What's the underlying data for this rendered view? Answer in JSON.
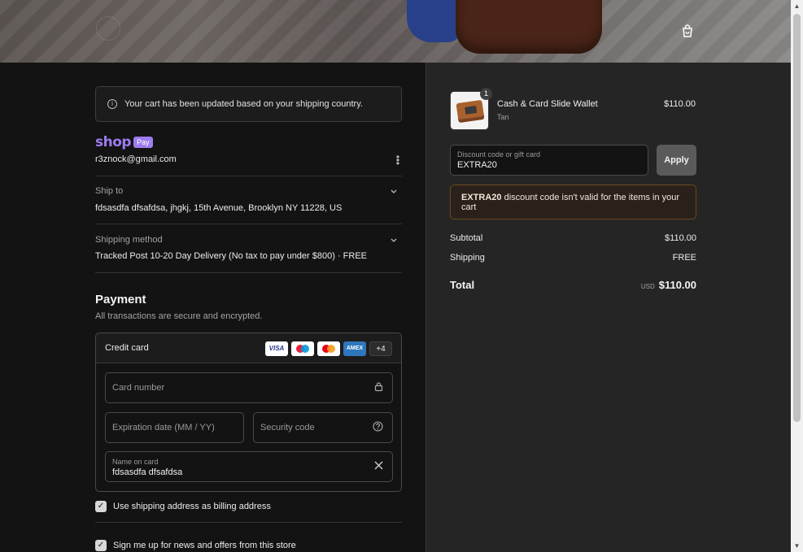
{
  "notice": {
    "text": "Your cart has been updated based on your shipping country.",
    "icon": "info-icon"
  },
  "shop_pay": {
    "brand_word": "shop",
    "badge": "Pay",
    "email": "r3znock@gmail.com"
  },
  "ship_to": {
    "label": "Ship to",
    "value": "fdsasdfa dfsafdsa, jhgkj, 15th Avenue, Brooklyn NY 11228, US"
  },
  "shipping_method": {
    "label": "Shipping method",
    "value": "Tracked Post 10-20 Day Delivery (No tax to pay under $800) · FREE"
  },
  "payment": {
    "title": "Payment",
    "subtitle": "All transactions are secure and encrypted.",
    "credit_card_label": "Credit card",
    "brands": [
      "VISA",
      "Maestro",
      "Mastercard",
      "AMEX"
    ],
    "more_brands": "+4",
    "card_number_placeholder": "Card number",
    "expiration_placeholder": "Expiration date (MM / YY)",
    "security_placeholder": "Security code",
    "name_label": "Name on card",
    "name_value": "fdsasdfa dfsafdsa",
    "billing_checkbox": "Use shipping address as billing address",
    "newsletter_checkbox": "Sign me up for news and offers from this store"
  },
  "order": {
    "product_name": "Cash & Card Slide Wallet",
    "variant": "Tan",
    "price": "$110.00",
    "quantity": "1",
    "discount_label": "Discount code or gift card",
    "discount_value": "EXTRA20",
    "apply_label": "Apply",
    "error_code": "EXTRA20",
    "error_text": " discount code isn't valid for the items in your cart",
    "subtotal_label": "Subtotal",
    "subtotal_value": "$110.00",
    "shipping_label": "Shipping",
    "shipping_value": "FREE",
    "total_label": "Total",
    "total_currency": "USD",
    "total_value": "$110.00"
  },
  "colors": {
    "shop_purple": "#9d7bf0",
    "left_bg": "#131313",
    "right_bg": "#252525",
    "error_border": "#6b4b1a"
  }
}
